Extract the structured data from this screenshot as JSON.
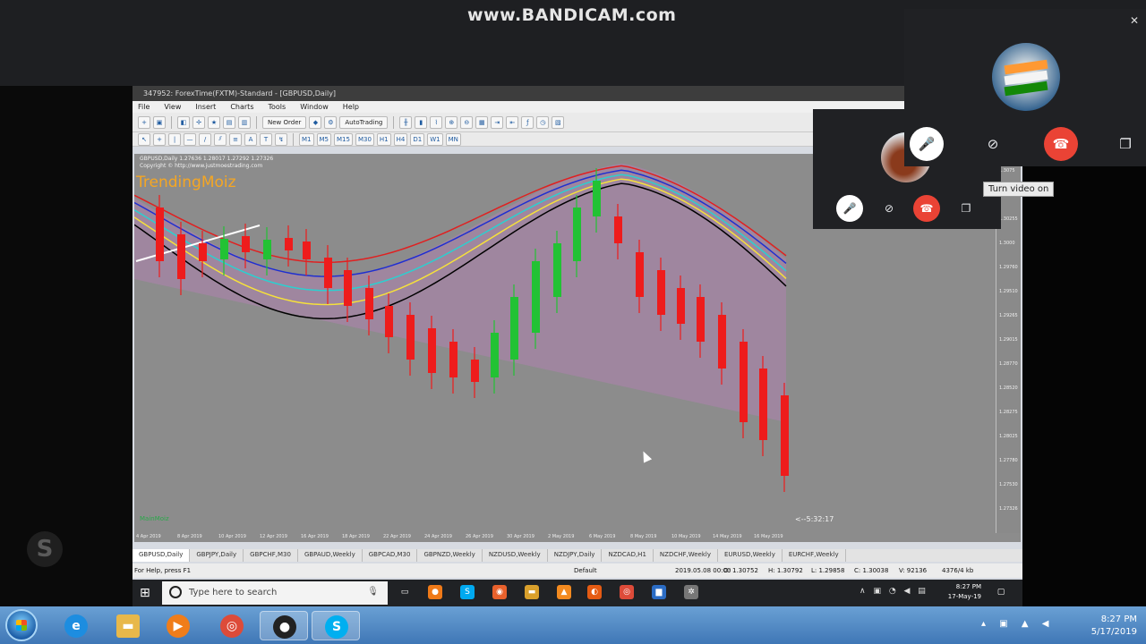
{
  "watermark": "www.BANDICAM.com",
  "mt4": {
    "title": "347952: ForexTime(FXTM)-Standard - [GBPUSD,Daily]",
    "menu": [
      "File",
      "View",
      "Insert",
      "Charts",
      "Tools",
      "Window",
      "Help"
    ],
    "toolbar": {
      "new_order": "New Order",
      "autotrading": "AutoTrading",
      "timeframes": [
        "M1",
        "M5",
        "M15",
        "M30",
        "H1",
        "H4",
        "D1",
        "W1",
        "MN"
      ]
    },
    "chart": {
      "header_line1": "GBPUSD,Daily  1.27636 1.28017 1.27292 1.27326",
      "header_line2": "Copyright © http://www.justmoestrading.com",
      "indicator_label": "TrendingMoiz",
      "countdown": "<--5:32:17",
      "corner_label": "MainMoiz",
      "date_labels": [
        "4 Apr 2019",
        "8 Apr 2019",
        "10 Apr 2019",
        "12 Apr 2019",
        "16 Apr 2019",
        "18 Apr 2019",
        "22 Apr 2019",
        "24 Apr 2019",
        "26 Apr 2019",
        "30 Apr 2019",
        "2 May 2019",
        "6 May 2019",
        "8 May 2019",
        "10 May 2019",
        "14 May 2019",
        "16 May 2019"
      ],
      "price_labels": [
        "1.3075",
        "1.3050",
        "1.30255",
        "1.3000",
        "1.29760",
        "1.29510",
        "1.29265",
        "1.29015",
        "1.28770",
        "1.28520",
        "1.28275",
        "1.28025",
        "1.27780",
        "1.27530",
        "1.27326"
      ],
      "colors": {
        "background": "#8c8c8c",
        "bull": "#22c234",
        "bear": "#ee1c1c",
        "ribbon": "#c27bc2"
      }
    },
    "tabs": [
      "GBPUSD,Daily",
      "GBPJPY,Daily",
      "GBPCHF,M30",
      "GBPAUD,Weekly",
      "GBPCAD,M30",
      "GBPNZD,Weekly",
      "NZDUSD,Weekly",
      "NZDJPY,Daily",
      "NZDCAD,H1",
      "NZDCHF,Weekly",
      "EURUSD,Weekly",
      "EURCHF,Weekly"
    ],
    "status": {
      "help": "For Help, press F1",
      "profile": "Default",
      "datetime": "2019.05.08 00:00",
      "open": "O: 1.30752",
      "high": "H: 1.30792",
      "low": "L: 1.29858",
      "close": "C: 1.30038",
      "volume": "V: 92136",
      "traffic": "4376/4 kb"
    }
  },
  "remote_taskbar": {
    "search_placeholder": "Type here to search",
    "clock_time": "8:27 PM",
    "clock_date": "17-May-19"
  },
  "local_taskbar": {
    "clock_time": "8:27 PM",
    "clock_date": "5/17/2019"
  },
  "call": {
    "tooltip": "Turn video on"
  }
}
